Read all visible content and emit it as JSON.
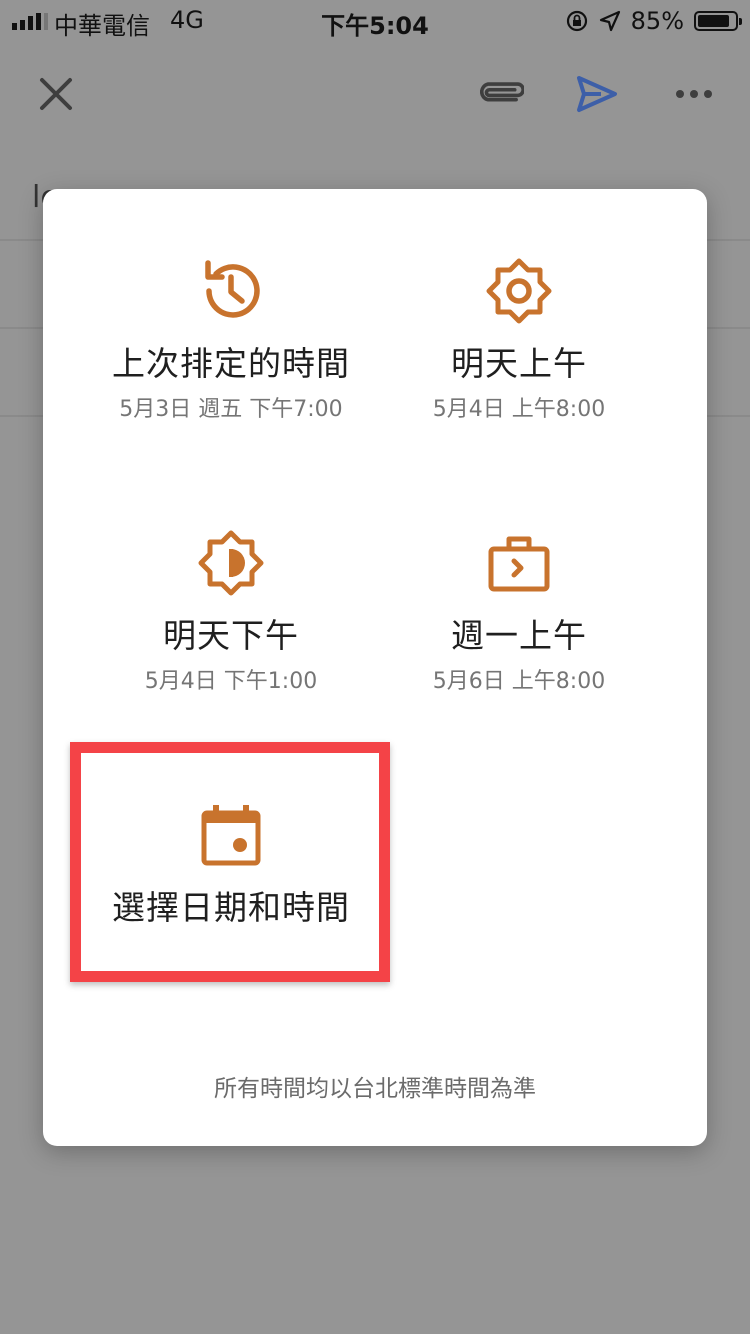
{
  "status_bar": {
    "carrier": "中華電信",
    "network": "4G",
    "time": "下午5:04",
    "battery_percent": "85%",
    "battery_level": 0.85
  },
  "background": {
    "line1_text": "le",
    "line2_text": "",
    "line3_text": "",
    "line4_text": ""
  },
  "dialog": {
    "options": [
      {
        "icon": "history-icon",
        "title": "上次排定的時間",
        "subtitle": "5月3日 週五 下午7:00"
      },
      {
        "icon": "morning-sun-icon",
        "title": "明天上午",
        "subtitle": "5月4日 上午8:00"
      },
      {
        "icon": "afternoon-sun-icon",
        "title": "明天下午",
        "subtitle": "5月4日 下午1:00"
      },
      {
        "icon": "work-briefcase-icon",
        "title": "週一上午",
        "subtitle": "5月6日 上午8:00"
      },
      {
        "icon": "calendar-icon",
        "title": "選擇日期和時間",
        "subtitle": ""
      }
    ],
    "footer_note": "所有時間均以台北標準時間為準"
  },
  "colors": {
    "accent": "#c8732d",
    "highlight_border": "#f44347",
    "send_icon": "#3d5fa8"
  }
}
